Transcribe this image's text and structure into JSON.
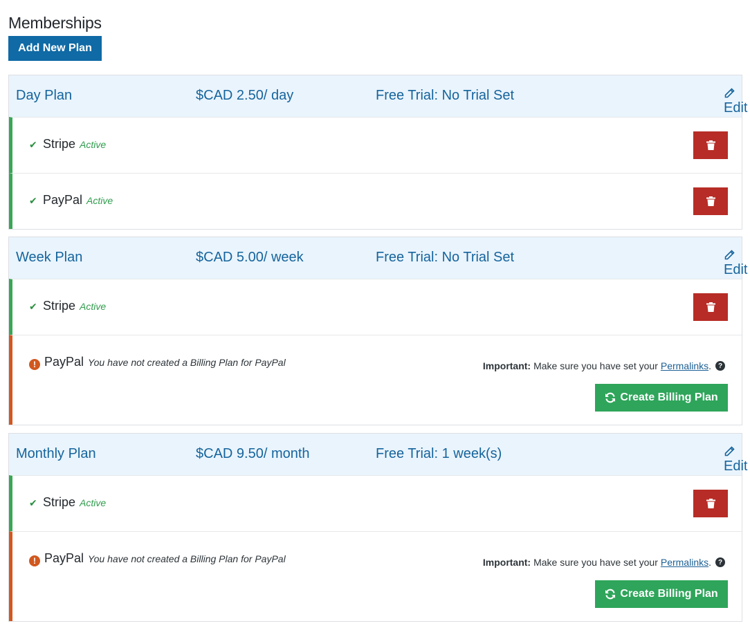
{
  "page": {
    "title": "Memberships",
    "add_button": "Add New Plan"
  },
  "colors": {
    "primary": "#0f6aa5",
    "danger": "#b72c26",
    "success": "#2ea55a",
    "active_border": "#3aa657",
    "warning_border": "#d1581f",
    "header_bg": "#eaf4fd"
  },
  "plans": [
    {
      "name": "Day Plan",
      "price": "$CAD 2.50/ day",
      "trial": "Free Trial: No Trial Set",
      "edit_label": "Edit",
      "gateways": [
        {
          "name": "Stripe",
          "status": "Active"
        },
        {
          "name": "PayPal",
          "status": "Active"
        }
      ]
    },
    {
      "name": "Week Plan",
      "price": "$CAD 5.00/ week",
      "trial": "Free Trial: No Trial Set",
      "edit_label": "Edit",
      "gateways": [
        {
          "name": "Stripe",
          "status": "Active"
        },
        {
          "name": "PayPal",
          "status": "You have not created a Billing Plan for PayPal",
          "important_label": "Important:",
          "important_text": "Make sure you have set your",
          "permalinks": "Permalinks",
          "period": ".",
          "create_button": "Create Billing Plan"
        }
      ]
    },
    {
      "name": "Monthly Plan",
      "price": "$CAD 9.50/ month",
      "trial": "Free Trial: 1 week(s)",
      "edit_label": "Edit",
      "gateways": [
        {
          "name": "Stripe",
          "status": "Active"
        },
        {
          "name": "PayPal",
          "status": "You have not created a Billing Plan for PayPal",
          "important_label": "Important:",
          "important_text": "Make sure you have set your",
          "permalinks": "Permalinks",
          "period": ".",
          "create_button": "Create Billing Plan"
        }
      ]
    }
  ]
}
